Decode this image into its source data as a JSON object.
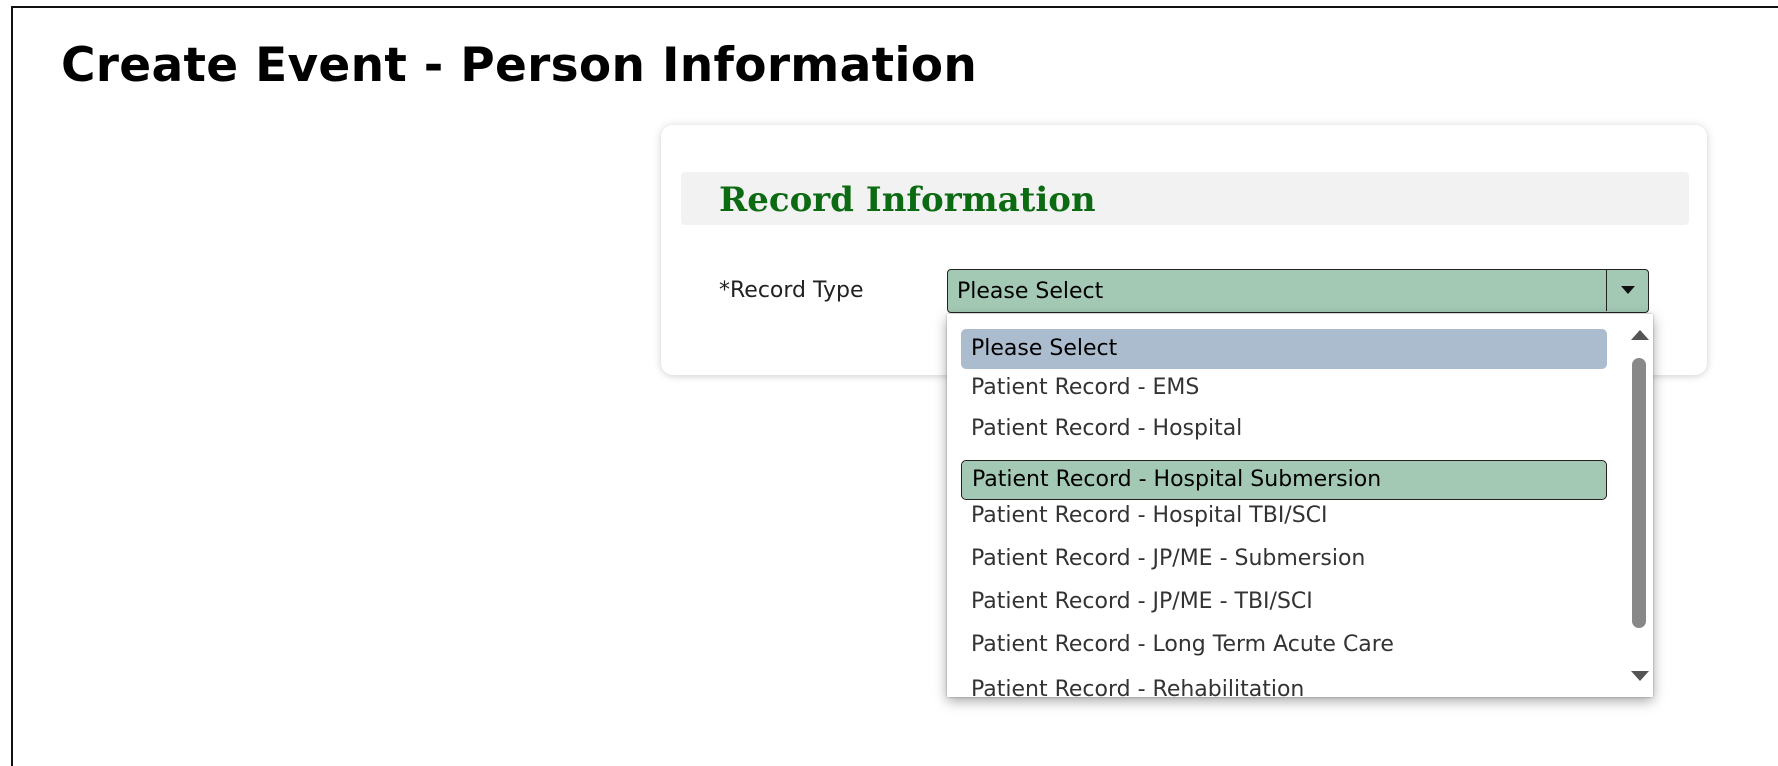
{
  "page": {
    "title": "Create Event - Person Information"
  },
  "record_section": {
    "title": "Record Information",
    "record_type_label": "*Record Type",
    "record_type_value": "Please Select"
  },
  "dropdown": {
    "options": [
      "Please Select",
      "Patient Record - EMS",
      "Patient Record - Hospital",
      "Patient Record - Hospital Submersion",
      "Patient Record - Hospital TBI/SCI",
      "Patient Record - JP/ME - Submersion",
      "Patient Record - JP/ME - TBI/SCI",
      "Patient Record - Long Term Acute Care",
      "Patient Record - Rehabilitation"
    ],
    "highlighted_option": "Please Select",
    "focused_option": "Patient Record - Hospital Submersion"
  },
  "colors": {
    "section_title": "#0c6b12",
    "select_fill": "#a3c9b5",
    "option_hover": "#acbccf"
  },
  "icons": {
    "select_arrow": "chevron-down-icon",
    "scroll_up": "scroll-up-arrow-icon",
    "scroll_down": "scroll-down-arrow-icon"
  }
}
